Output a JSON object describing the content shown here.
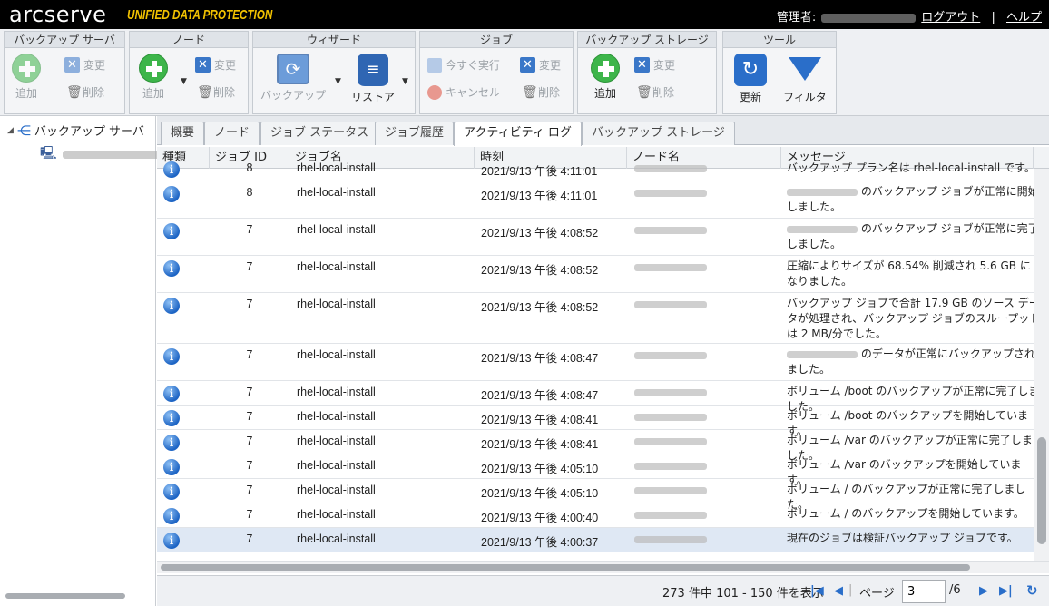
{
  "header": {
    "logo": "arcserve",
    "logo_sub": "UNIFIED DATA PROTECTION",
    "admin_label": "管理者:",
    "logout": "ログアウト",
    "separator": "|",
    "help": "ヘルプ"
  },
  "toolbar": {
    "groups": {
      "backup_server": {
        "title": "バックアップ サーバ",
        "add": "追加",
        "change": "変更",
        "delete": "削除"
      },
      "node": {
        "title": "ノード",
        "add": "追加",
        "change": "変更",
        "delete": "削除"
      },
      "wizard": {
        "title": "ウィザード",
        "backup": "バックアップ",
        "restore": "リストア"
      },
      "job": {
        "title": "ジョブ",
        "run_now": "今すぐ実行",
        "change": "変更",
        "cancel": "キャンセル",
        "delete": "削除"
      },
      "storage": {
        "title": "バックアップ ストレージ",
        "add": "追加",
        "change": "変更",
        "delete": "削除"
      },
      "tools": {
        "title": "ツール",
        "refresh": "更新",
        "filter": "フィルタ"
      }
    }
  },
  "sidebar": {
    "root_label": "バックアップ サーバ"
  },
  "tabs": [
    "概要",
    "ノード",
    "ジョブ ステータス",
    "ジョブ履歴",
    "アクティビティ ログ",
    "バックアップ ストレージ"
  ],
  "active_tab": 4,
  "grid": {
    "columns": [
      "種類",
      "ジョブ ID",
      "ジョブ名",
      "時刻",
      "ノード名",
      "メッセージ"
    ],
    "rows": [
      {
        "id": "8",
        "name": "rhel-local-install",
        "time": "2021/9/13 午後 4:11:01",
        "msg": "バックアップ プラン名は rhel-local-install です。",
        "blur_prefix": false
      },
      {
        "id": "8",
        "name": "rhel-local-install",
        "time": "2021/9/13 午後 4:11:01",
        "msg": " のバックアップ ジョブが正常に開始しました。",
        "blur_prefix": true
      },
      {
        "id": "7",
        "name": "rhel-local-install",
        "time": "2021/9/13 午後 4:08:52",
        "msg": " のバックアップ ジョブが正常に完了しました。",
        "blur_prefix": true
      },
      {
        "id": "7",
        "name": "rhel-local-install",
        "time": "2021/9/13 午後 4:08:52",
        "msg": "圧縮によりサイズが 68.54% 削減され 5.6 GB になりました。",
        "blur_prefix": false
      },
      {
        "id": "7",
        "name": "rhel-local-install",
        "time": "2021/9/13 午後 4:08:52",
        "msg": "バックアップ ジョブで合計 17.9 GB のソース データが処理され、バックアップ ジョブのスループットは 2 MB/分でした。",
        "blur_prefix": false
      },
      {
        "id": "7",
        "name": "rhel-local-install",
        "time": "2021/9/13 午後 4:08:47",
        "msg": " のデータが正常にバックアップされました。",
        "blur_prefix": true
      },
      {
        "id": "7",
        "name": "rhel-local-install",
        "time": "2021/9/13 午後 4:08:47",
        "msg": "ボリューム /boot のバックアップが正常に完了しました。",
        "blur_prefix": false
      },
      {
        "id": "7",
        "name": "rhel-local-install",
        "time": "2021/9/13 午後 4:08:41",
        "msg": "ボリューム /boot のバックアップを開始しています。",
        "blur_prefix": false
      },
      {
        "id": "7",
        "name": "rhel-local-install",
        "time": "2021/9/13 午後 4:08:41",
        "msg": "ボリューム /var のバックアップが正常に完了しました。",
        "blur_prefix": false
      },
      {
        "id": "7",
        "name": "rhel-local-install",
        "time": "2021/9/13 午後 4:05:10",
        "msg": "ボリューム /var のバックアップを開始しています。",
        "blur_prefix": false
      },
      {
        "id": "7",
        "name": "rhel-local-install",
        "time": "2021/9/13 午後 4:05:10",
        "msg": "ボリューム / のバックアップが正常に完了しました。",
        "blur_prefix": false
      },
      {
        "id": "7",
        "name": "rhel-local-install",
        "time": "2021/9/13 午後 4:00:40",
        "msg": "ボリューム / のバックアップを開始しています。",
        "blur_prefix": false
      },
      {
        "id": "7",
        "name": "rhel-local-install",
        "time": "2021/9/13 午後 4:00:37",
        "msg": "現在のジョブは検証バックアップ ジョブです。",
        "blur_prefix": false
      }
    ]
  },
  "pager": {
    "summary": "273 件中 101 - 150 件を表示",
    "page_label": "ページ",
    "page_value": "3",
    "total_pages": "/6"
  }
}
